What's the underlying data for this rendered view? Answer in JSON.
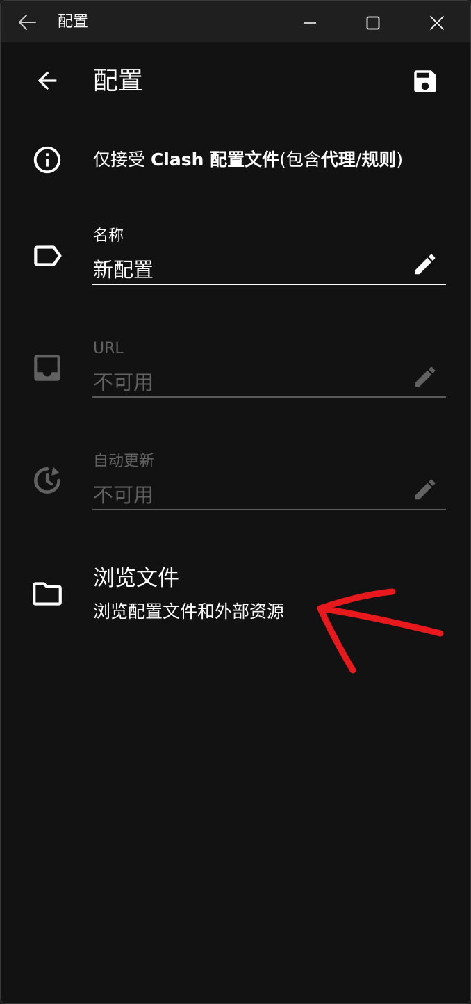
{
  "window": {
    "title": "配置"
  },
  "appbar": {
    "title": "配置"
  },
  "info": {
    "prefix": "仅接受 ",
    "bold1": "Clash 配置文件",
    "middle": "(包含",
    "bold2": "代理",
    "slash": "/",
    "bold3": "规则",
    "suffix": ")"
  },
  "fields": {
    "name": {
      "label": "名称",
      "value": "新配置"
    },
    "url": {
      "label": "URL",
      "value": "不可用"
    },
    "auto_update": {
      "label": "自动更新",
      "value": "不可用"
    }
  },
  "browse": {
    "title": "浏览文件",
    "subtitle": "浏览配置文件和外部资源"
  },
  "colors": {
    "background": "#121212",
    "titlebar": "#1f1f1f",
    "text": "#ffffff",
    "disabled": "#616161",
    "annotation": "#e8191c"
  },
  "icons": {
    "titlebar_back": "arrow-left-icon",
    "minimize": "minimize-icon",
    "maximize": "maximize-icon",
    "close": "close-icon",
    "appbar_back": "arrow-left-icon",
    "save": "save-icon",
    "info": "info-icon",
    "name": "label-icon",
    "url": "inbox-icon",
    "auto_update": "update-icon",
    "edit": "pencil-icon",
    "browse": "folder-icon"
  }
}
